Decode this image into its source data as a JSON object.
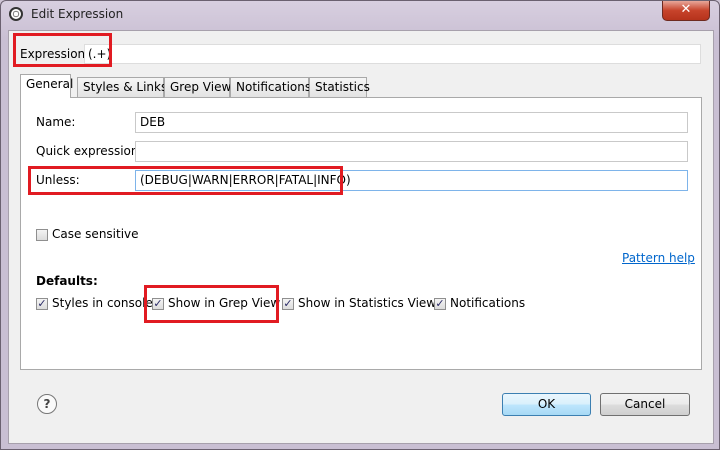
{
  "window": {
    "title": "Edit Expression",
    "close_glyph": "✕"
  },
  "expression": {
    "label": "Expression:",
    "value": "(.+)"
  },
  "tabs": [
    {
      "label": "General"
    },
    {
      "label": "Styles & Links"
    },
    {
      "label": "Grep View"
    },
    {
      "label": "Notifications"
    },
    {
      "label": "Statistics"
    }
  ],
  "general": {
    "name_label": "Name:",
    "name_value": "DEB",
    "quick_label": "Quick expression:",
    "quick_value": "",
    "unless_label": "Unless:",
    "unless_value": "(DEBUG|WARN|ERROR|FATAL|INFO)",
    "case_sensitive_label": "Case sensitive",
    "pattern_help": "Pattern help",
    "defaults_label": "Defaults:",
    "defaults": [
      {
        "label": "Styles in console",
        "checked": true
      },
      {
        "label": "Show in Grep View",
        "checked": true
      },
      {
        "label": "Show in Statistics View",
        "checked": true
      },
      {
        "label": "Notifications",
        "checked": true
      }
    ]
  },
  "buttons": {
    "ok": "OK",
    "cancel": "Cancel",
    "help": "?"
  },
  "icons": {
    "check": "✓",
    "app": "eclipse-icon",
    "help": "help-icon"
  },
  "colors": {
    "highlight": "#e11b22",
    "link": "#0066cc"
  }
}
